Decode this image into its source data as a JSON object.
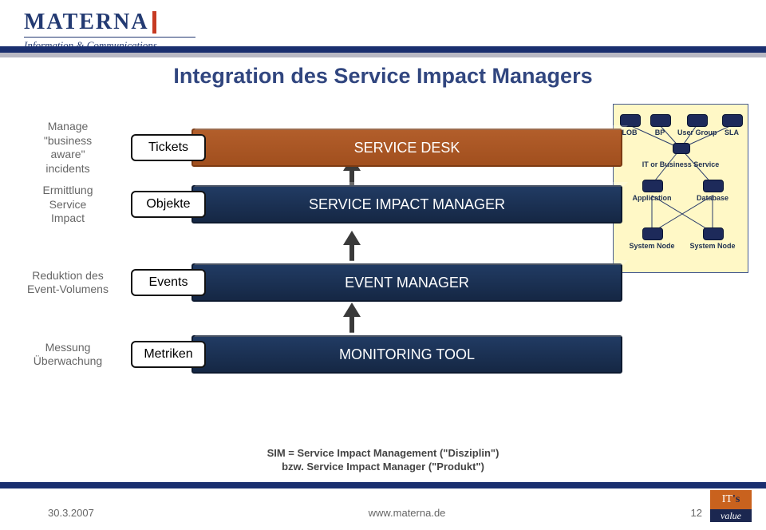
{
  "logo": {
    "name": "MATERNA",
    "tagline": "Information & Communications"
  },
  "title": "Integration des Service Impact Managers",
  "rows": [
    {
      "desc_line1": "Manage",
      "desc_line2": "\"business",
      "desc_line3": "aware\"",
      "desc_line4": "incidents",
      "chip": "Tickets",
      "bar": "SERVICE DESK"
    },
    {
      "desc_line1": "Ermittlung",
      "desc_line2": "Service",
      "desc_line3": "Impact",
      "desc_line4": "",
      "chip": "Objekte",
      "bar": "SERVICE IMPACT MANAGER"
    },
    {
      "desc_line1": "Reduktion des",
      "desc_line2": "Event-Volumens",
      "desc_line3": "",
      "desc_line4": "",
      "chip": "Events",
      "bar": "EVENT MANAGER"
    },
    {
      "desc_line1": "Messung",
      "desc_line2": "Überwachung",
      "desc_line3": "",
      "desc_line4": "",
      "chip": "Metriken",
      "bar": "MONITORING TOOL"
    }
  ],
  "tree": {
    "top": [
      "LOB",
      "BP",
      "User Group",
      "SLA"
    ],
    "mid_title": "IT or Business Service",
    "mid": [
      "Application",
      "Database"
    ],
    "leaf": [
      "System Node",
      "System Node"
    ]
  },
  "sim_caption_line1": "SIM = Service Impact Management (\"Disziplin\")",
  "sim_caption_line2": "bzw. Service Impact Manager (\"Produkt\")",
  "footer": {
    "date": "30.3.2007",
    "url": "www.materna.de",
    "page": "12"
  },
  "badge": {
    "top_left": "IT",
    "top_right": "'s",
    "bottom": "value"
  }
}
